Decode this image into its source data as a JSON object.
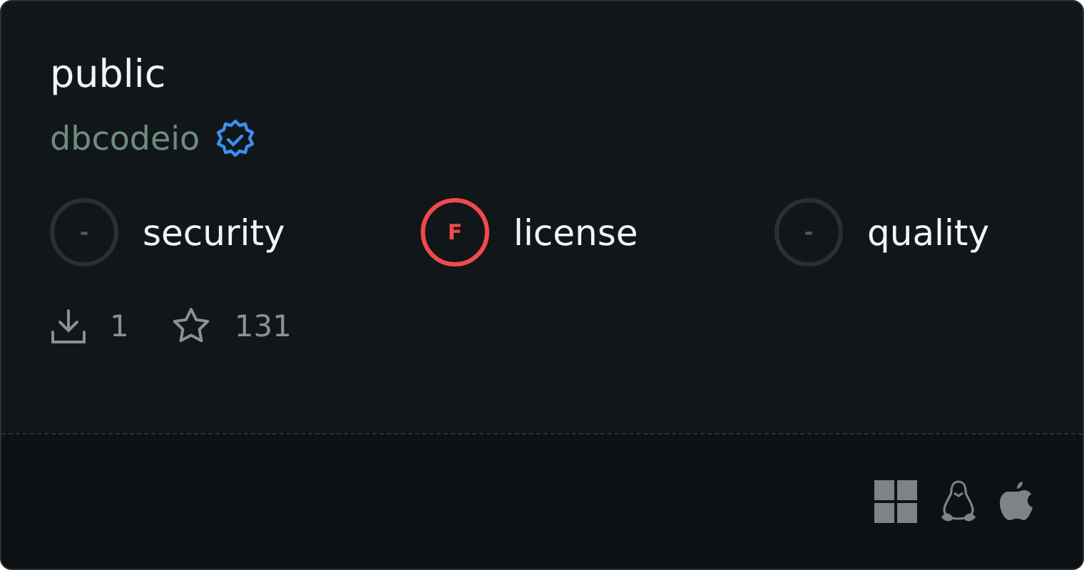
{
  "package": {
    "name": "public",
    "owner": "dbcodeio",
    "verified": true
  },
  "scores": [
    {
      "grade": "-",
      "label": "security",
      "color": "#2a2f33"
    },
    {
      "grade": "F",
      "label": "license",
      "color": "#f04a4a"
    },
    {
      "grade": "-",
      "label": "quality",
      "color": "#2a2f33"
    }
  ],
  "stats": {
    "downloads": "1",
    "stars": "131"
  },
  "platforms": [
    {
      "kind": "windows"
    },
    {
      "kind": "linux"
    },
    {
      "kind": "apple"
    }
  ]
}
